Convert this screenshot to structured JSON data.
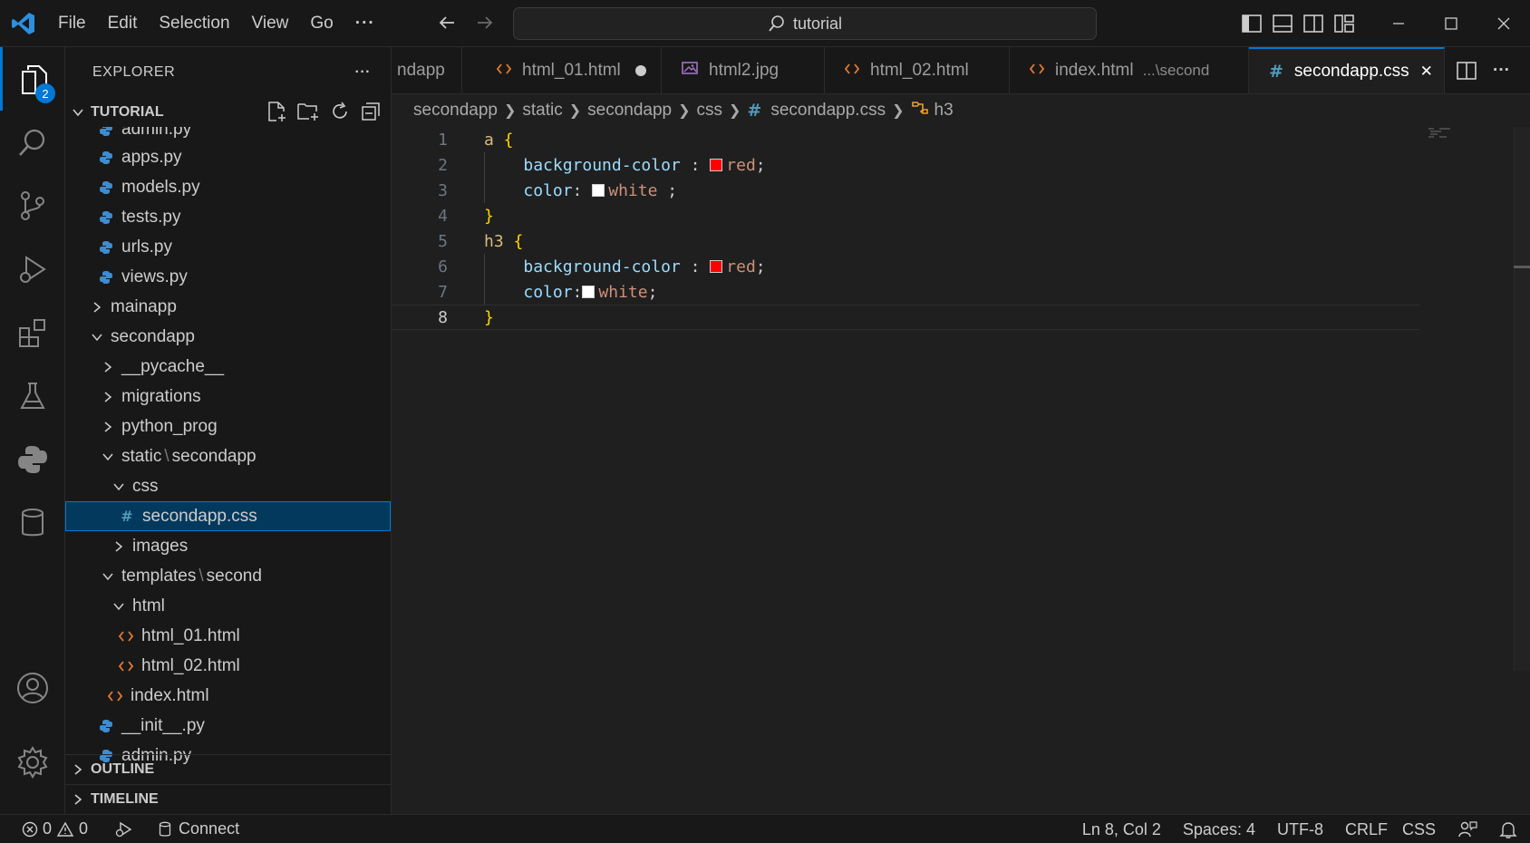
{
  "colors": {
    "accent": "#0078d4",
    "css_icon": "#519aba",
    "html_icon": "#e37933",
    "python_icon": "#3e8dd0",
    "image_icon": "#a074c4"
  },
  "titlebar": {
    "menu": [
      "File",
      "Edit",
      "Selection",
      "View",
      "Go",
      "···"
    ],
    "search": "tutorial"
  },
  "activity": {
    "badge": "2"
  },
  "sidebar": {
    "title": "EXPLORER",
    "more": "···",
    "root": "TUTORIAL",
    "tree": [
      {
        "label": "admin.py",
        "icon": "python"
      },
      {
        "label": "apps.py",
        "icon": "python"
      },
      {
        "label": "models.py",
        "icon": "python"
      },
      {
        "label": "tests.py",
        "icon": "python"
      },
      {
        "label": "urls.py",
        "icon": "python"
      },
      {
        "label": "views.py",
        "icon": "python"
      },
      {
        "label": "mainapp",
        "icon": "chevron-right"
      },
      {
        "label": "secondapp",
        "icon": "chevron-down"
      },
      {
        "label": "__pycache__",
        "icon": "chevron-right"
      },
      {
        "label": "migrations",
        "icon": "chevron-right"
      },
      {
        "label": "python_prog",
        "icon": "chevron-right"
      },
      {
        "label_a": "static",
        "label_b": "secondapp",
        "icon": "chevron-down"
      },
      {
        "label": "css",
        "icon": "chevron-down"
      },
      {
        "label": "secondapp.css",
        "icon": "css"
      },
      {
        "label": "images",
        "icon": "chevron-right"
      },
      {
        "label_a": "templates",
        "label_b": "second",
        "icon": "chevron-down"
      },
      {
        "label": "html",
        "icon": "chevron-down"
      },
      {
        "label": "html_01.html",
        "icon": "html"
      },
      {
        "label": "html_02.html",
        "icon": "html"
      },
      {
        "label": "index.html",
        "icon": "html"
      },
      {
        "label": "__init__.py",
        "icon": "python"
      },
      {
        "label": "admin.py",
        "icon": "python"
      }
    ],
    "separator": "\\",
    "outline": "OUTLINE",
    "timeline": "TIMELINE"
  },
  "tabs": [
    {
      "label": "ndapp",
      "icon": "none"
    },
    {
      "label": "html_01.html",
      "icon": "html",
      "modified": true
    },
    {
      "label": "html2.jpg",
      "icon": "image"
    },
    {
      "label": "html_02.html",
      "icon": "html"
    },
    {
      "label": "index.html",
      "icon": "html",
      "desc": "...\\second"
    },
    {
      "label": "secondapp.css",
      "icon": "css",
      "active": true,
      "close": "✕"
    }
  ],
  "tab_actions_more": "···",
  "breadcrumb": {
    "parts": [
      "secondapp",
      "static",
      "secondapp",
      "css",
      "secondapp.css",
      "h3"
    ],
    "icon_hash": "#"
  },
  "editor": {
    "line_numbers": [
      "1",
      "2",
      "3",
      "4",
      "5",
      "6",
      "7",
      "8"
    ],
    "current_line": 8,
    "lines": {
      "l1_sel": "a",
      "l1_brace": " {",
      "l2_prop": "background-color",
      "l2_colon": " : ",
      "l2_val": "red",
      "l2_end": ";",
      "l3_prop": "color",
      "l3_colon": ": ",
      "l3_val": "white",
      "l3_end": " ;",
      "l4_brace": "}",
      "l5_sel": "h3",
      "l5_brace": " {",
      "l6_prop": "background-color",
      "l6_colon": " : ",
      "l6_val": "red",
      "l6_end": ";",
      "l7_prop": "color",
      "l7_colon": ":",
      "l7_val": "white",
      "l7_end": ";",
      "l8_brace": "}"
    },
    "swatch_red": "#ff0000",
    "swatch_white": "#ffffff"
  },
  "statusbar": {
    "errors": "0",
    "warnings": "0",
    "connect": "Connect",
    "position": "Ln 8, Col 2",
    "spaces": "Spaces: 4",
    "encoding": "UTF-8",
    "eol": "CRLF",
    "language": "CSS"
  }
}
